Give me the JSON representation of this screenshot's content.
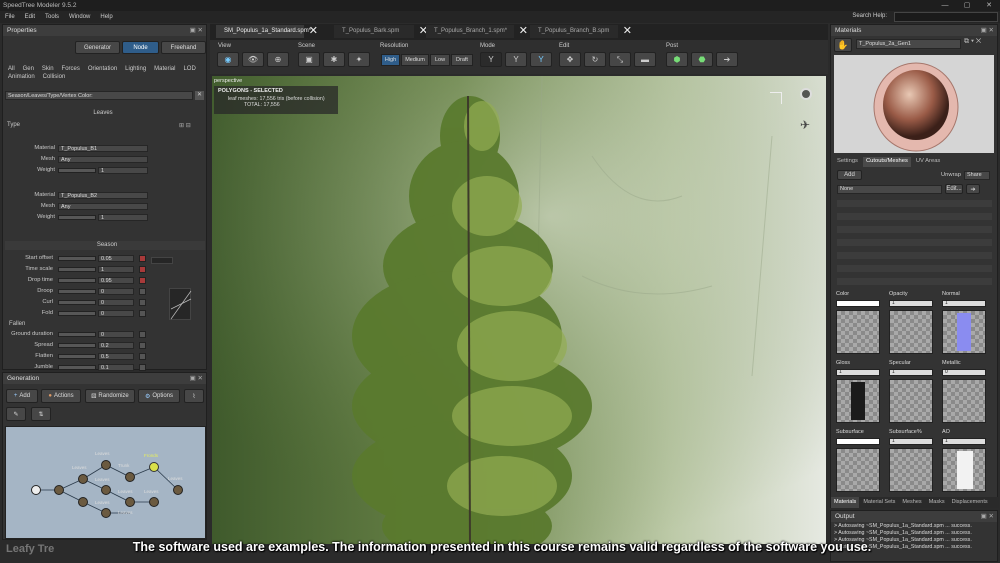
{
  "app": {
    "title": "SpeedTree Modeler 9.5.2",
    "search_help": "Search Help:"
  },
  "menu": [
    "File",
    "Edit",
    "Tools",
    "Window",
    "Help"
  ],
  "properties": {
    "title": "Properties",
    "mode_buttons": [
      "Generator",
      "Node",
      "Freehand"
    ],
    "tabs_row1": [
      "All",
      "Gen",
      "Skin",
      "Forces",
      "Orientation",
      "Lighting",
      "Material",
      "LOD"
    ],
    "tabs_row2": [
      "Animation",
      "Collision"
    ],
    "search_value": "Season/Leaves/Type/Vertex Color:",
    "leaves_header": "Leaves",
    "type_label": "Type",
    "type1": {
      "material_label": "Material",
      "material": "T_Populus_B1",
      "mesh_label": "Mesh",
      "mesh": "Any",
      "weight_label": "Weight",
      "weight": "1"
    },
    "type2": {
      "material_label": "Material",
      "material": "T_Populus_B2",
      "mesh_label": "Mesh",
      "mesh": "Any",
      "weight_label": "Weight",
      "weight": "1"
    },
    "season_header": "Season",
    "season_rows": [
      {
        "label": "Start offset",
        "value": "0.05"
      },
      {
        "label": "Time scale",
        "value": "1"
      },
      {
        "label": "Drop time",
        "value": "0.95"
      },
      {
        "label": "Droop",
        "value": "0"
      },
      {
        "label": "Curl",
        "value": "0"
      },
      {
        "label": "Fold",
        "value": "0"
      }
    ],
    "fallen_label": "Fallen",
    "fallen_rows": [
      {
        "label": "Ground duration",
        "value": "0"
      },
      {
        "label": "Spread",
        "value": "0.2"
      },
      {
        "label": "Flatten",
        "value": "0.5"
      },
      {
        "label": "Jumble",
        "value": "0.1"
      }
    ]
  },
  "generation": {
    "title": "Generation",
    "buttons": [
      "Add",
      "Actions",
      "Randomize",
      "Options"
    ],
    "nodes": [
      "Leaves",
      "Leaves",
      "Leaves",
      "Trunk",
      "Fronds",
      "Leaves",
      "Leaves",
      "Leaves",
      "Leaves",
      "Leaves"
    ]
  },
  "doc_tabs": [
    "SM_Populus_1a_Standard.spm*",
    "T_Populus_Bark.spm",
    "T_Populus_Branch_1.spm*",
    "T_Populus_Branch_B.spm"
  ],
  "toolbar": {
    "groups": [
      "View",
      "Scene",
      "Resolution",
      "Mode",
      "Edit",
      "Post"
    ],
    "resolution": [
      "High",
      "Medium",
      "Low",
      "Draft"
    ]
  },
  "viewport": {
    "camera_label": "perspective",
    "stats_title": "POLYGONS - SELECTED",
    "stats_leaf_label": "leaf meshes:",
    "stats_leaf_value": "17,556 tris (before collision)",
    "stats_total_label": "TOTAL:",
    "stats_total_value": "17,556"
  },
  "materials": {
    "title": "Materials",
    "selected": "T_Populus_2a_Gen1",
    "tabs": [
      "Settings",
      "Cutouts/Meshes",
      "UV Areas"
    ],
    "add_label": "Add",
    "unwrap_label": "Unwrap",
    "unwrap_value": "Share",
    "none_value": "None",
    "edit_label": "Edit...",
    "maps": [
      {
        "label": "Color",
        "value": ""
      },
      {
        "label": "Opacity",
        "value": "1"
      },
      {
        "label": "Normal",
        "value": "1"
      },
      {
        "label": "Gloss",
        "value": "1"
      },
      {
        "label": "Specular",
        "value": "1"
      },
      {
        "label": "Metallic",
        "value": "0"
      },
      {
        "label": "Subsurface",
        "value": ""
      },
      {
        "label": "Subsurface%",
        "value": "1"
      },
      {
        "label": "AO",
        "value": "1"
      }
    ],
    "bottom_tabs": [
      "Materials",
      "Material Sets",
      "Meshes",
      "Masks",
      "Displacements"
    ]
  },
  "output": {
    "title": "Output",
    "lines": [
      "> Autosaving ~SM_Populus_1a_Standard.spm ... success.",
      "> Autosaving ~SM_Populus_1a_Standard.spm ... success.",
      "> Autosaving ~SM_Populus_1a_Standard.spm ... success.",
      "> Autosaving ~SM_Populus_1a_Standard.spm ... success."
    ]
  },
  "caption": "The software used are examples. The information presented in this course remains valid regardless of the software you use.",
  "watermark": "Leafy Tre"
}
